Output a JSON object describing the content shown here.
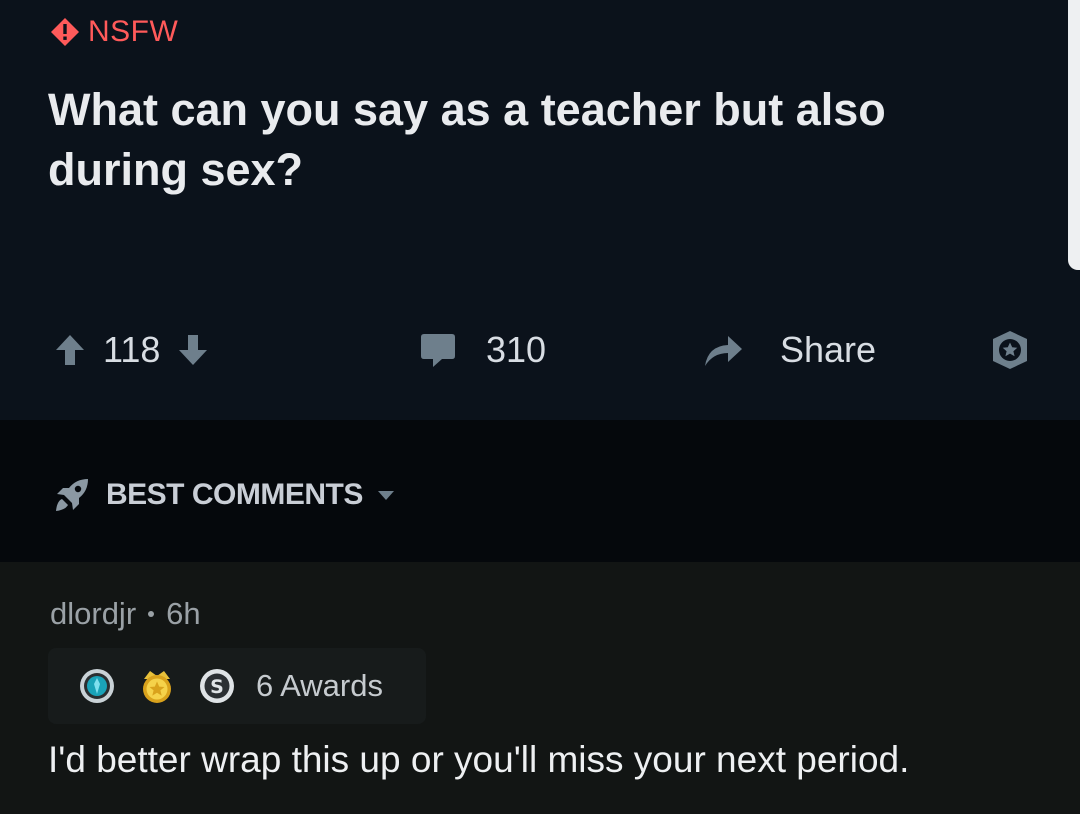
{
  "post": {
    "nsfw_label": "NSFW",
    "title": "What can you say as a teacher but also during sex?",
    "score": "118",
    "comment_count": "310",
    "share_label": "Share"
  },
  "sort": {
    "label": "BEST COMMENTS"
  },
  "comment": {
    "author": "dlordjr",
    "age": "6h",
    "awards_label": "6 Awards",
    "body": "I'd better wrap this up or you'll miss your next period."
  },
  "icons": {
    "nsfw": "nsfw-diamond-icon",
    "upvote": "upvote-arrow-icon",
    "downvote": "downvote-arrow-icon",
    "comments": "comment-bubble-icon",
    "share": "share-arrow-icon",
    "save": "save-badge-icon",
    "sort": "rocket-icon",
    "awards": [
      "platinum-award-icon",
      "gold-award-icon",
      "silver-award-icon"
    ]
  },
  "colors": {
    "post_bg": "#0b121b",
    "sort_bg": "#05080c",
    "comment_bg": "#121514",
    "nsfw": "#ff5a5a",
    "icon": "#6e7f8c"
  }
}
